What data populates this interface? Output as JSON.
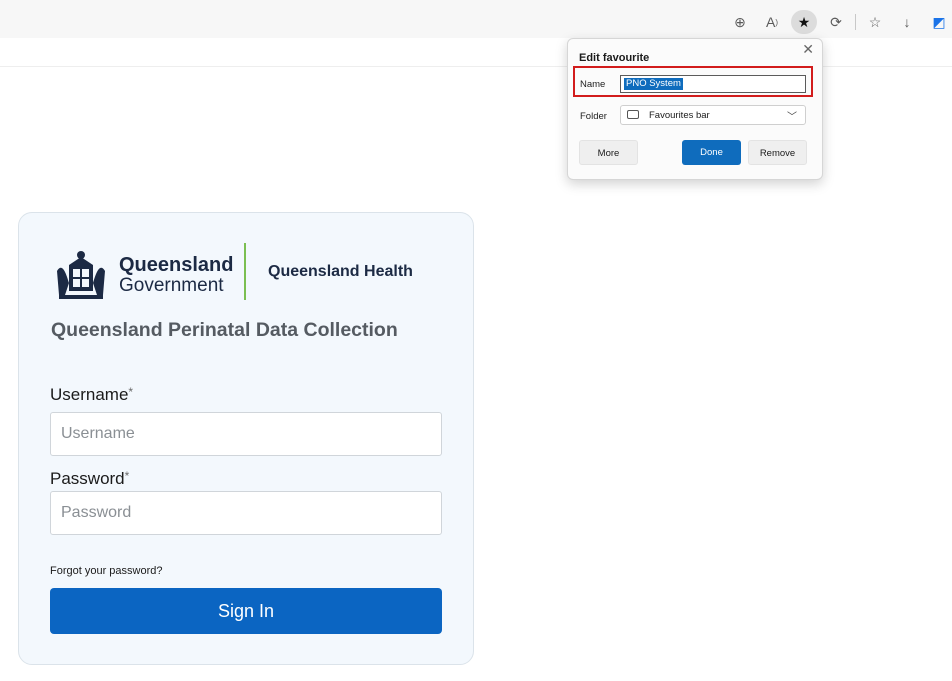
{
  "toolbar": {
    "icons": [
      "zoom-icon",
      "read-aloud-icon",
      "favourite-star-icon",
      "extensions-icon",
      "favourites-icon",
      "downloads-icon",
      "copilot-icon"
    ]
  },
  "popup": {
    "title": "Edit favourite",
    "name_label": "Name",
    "name_value": "PNO System",
    "folder_label": "Folder",
    "folder_value": "Favourites bar",
    "more_label": "More",
    "done_label": "Done",
    "remove_label": "Remove"
  },
  "login": {
    "gov_name": "Queensland",
    "gov_sub": "Government",
    "health": "Queensland Health",
    "app_title": "Queensland Perinatal Data Collection",
    "username_label": "Username",
    "username_placeholder": "Username",
    "password_label": "Password",
    "password_placeholder": "Password",
    "required_mark": "*",
    "forgot": "Forgot your password?",
    "signin": "Sign In"
  },
  "colors": {
    "brand_blue": "#0b65c2",
    "highlight_red": "#d21c1c",
    "health_green": "#7bbf52"
  }
}
